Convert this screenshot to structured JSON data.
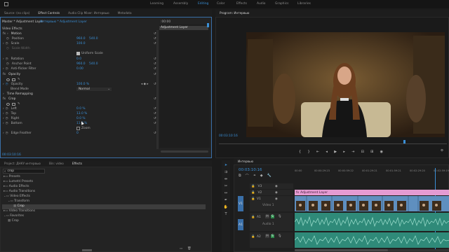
{
  "workspaces": [
    "Learning",
    "Assembly",
    "Editing",
    "Color",
    "Effects",
    "Audio",
    "Graphics",
    "Libraries"
  ],
  "active_workspace": "Editing",
  "top_tabs": [
    "Source: (no clips)",
    "Effect Controls",
    "Audio Clip Mixer: Интервью",
    "Metadata"
  ],
  "program_tab": "Program: Интервью",
  "effect_controls": {
    "master": "Master * Adjustment Layer",
    "sequence": "Интервью * Adjustment Layer",
    "timecode": ":00:00",
    "clip_label": "Adjustment Layer",
    "video_effects": "Video Effects",
    "motion": "Motion",
    "position_label": "Position",
    "position_x": "960.0",
    "position_y": "540.0",
    "scale_label": "Scale",
    "scale_val": "100.0",
    "scale_width_label": "Scale Width",
    "uniform_scale": "Uniform Scale",
    "rotation_label": "Rotation",
    "rotation_val": "0.0",
    "anchor_label": "Anchor Point",
    "anchor_x": "960.0",
    "anchor_y": "540.0",
    "antiflicker_label": "Anti-flicker Filter",
    "antiflicker_val": "0.00",
    "opacity_section": "Opacity",
    "opacity_label": "Opacity",
    "opacity_val": "100.0 %",
    "blend_label": "Blend Mode",
    "blend_val": "Normal",
    "time_remap": "Time Remapping",
    "crop_section": "Crop",
    "left_label": "Left",
    "left_val": "0.0 %",
    "top_label": "Top",
    "top_val": "13.0 %",
    "right_label": "Right",
    "right_val": "0.0 %",
    "bottom_label": "Bottom",
    "bottom_val": "11.0 %",
    "zoom_label": "Zoom",
    "edge_label": "Edge Feather",
    "edge_val": "0",
    "footer_time": "00:03:10:16"
  },
  "program": {
    "timecode": "00:03:10:16",
    "fit": "Fit"
  },
  "project": {
    "tabs": [
      "Project: ДНКУ интервью",
      "Bin: video",
      "Effects"
    ],
    "search_value": "crop",
    "tree": [
      "Presets",
      "Lumetri Presets",
      "Audio Effects",
      "Audio Transitions",
      "Video Effects",
      "Transform",
      "Crop",
      "Video Transitions",
      "Favorites",
      "Crop"
    ]
  },
  "timeline": {
    "sequence_tab": "Интервью",
    "timecode": "00:03:10:16",
    "ruler": [
      "00:00",
      "00:00:29:23",
      "00:00:59:22",
      "00:01:29:21",
      "00:01:59:21",
      "00:02:29:20",
      "00:02:59:19",
      "00:03:29:18"
    ],
    "tracks": [
      "V3",
      "V2",
      "V1",
      "A1",
      "A2"
    ],
    "track_names": [
      "Video 1",
      "Audio 1"
    ],
    "adjustment_label": "Adjustment Layer",
    "source_labels": [
      "V1",
      "A1"
    ],
    "colors": {
      "adjustment": "#e59bd2",
      "video_clip": "#5f8fbf",
      "audio_clip": "#2f8a79",
      "accent": "#3a8fd6"
    }
  }
}
